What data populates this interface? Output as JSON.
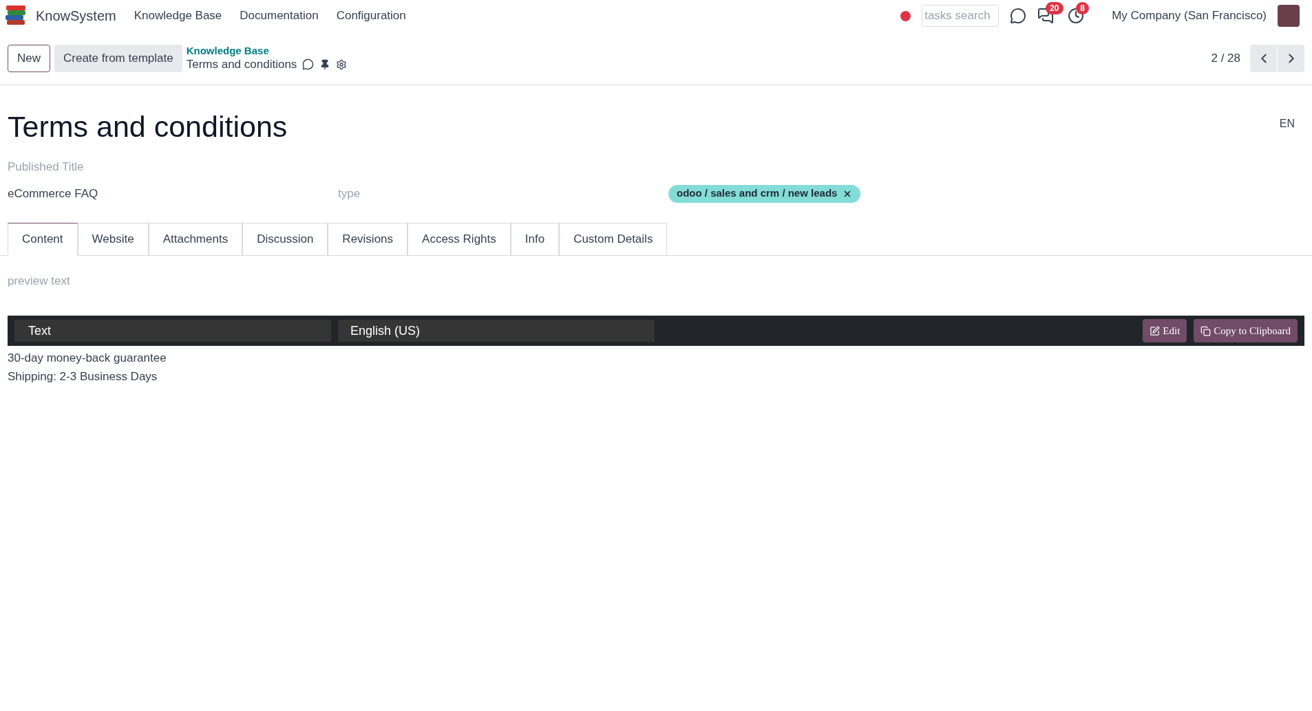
{
  "app": {
    "name": "KnowSystem"
  },
  "menu": [
    "Knowledge Base",
    "Documentation",
    "Configuration"
  ],
  "systray": {
    "recording": true,
    "search": {
      "placeholder": "tasks search"
    },
    "messages_badge": "20",
    "activities_badge": "8",
    "company": "My Company (San Francisco)"
  },
  "control_panel": {
    "buttons": [
      {
        "label": "New",
        "kind": "outline"
      },
      {
        "label": "Create from template",
        "kind": "secondary"
      }
    ],
    "breadcrumb": "Knowledge Base",
    "current": "Terms and conditions",
    "pager": "2 / 28"
  },
  "form": {
    "title": "Terms and conditions",
    "language": "EN",
    "published_title_placeholder": "Published Title",
    "section": "eCommerce FAQ",
    "type_placeholder": "type",
    "tags": [
      {
        "label": "odoo / sales and crm / new leads",
        "color": "#83dcd7"
      }
    ]
  },
  "tabs": [
    {
      "label": "Content",
      "selected": true
    },
    {
      "label": "Website",
      "selected": false
    },
    {
      "label": "Attachments",
      "selected": false
    },
    {
      "label": "Discussion",
      "selected": false
    },
    {
      "label": "Revisions",
      "selected": false
    },
    {
      "label": "Access Rights",
      "selected": false
    },
    {
      "label": "Info",
      "selected": false
    },
    {
      "label": "Custom Details",
      "selected": false
    }
  ],
  "content": {
    "preview_placeholder": "preview text",
    "editor": {
      "style": "Text",
      "language": "English (US)",
      "buttons": [
        {
          "label": "Edit",
          "kind": "edit"
        },
        {
          "label": "Copy to Clipboard",
          "kind": "copy"
        }
      ]
    },
    "lines": [
      "30-day money-back guarantee",
      "Shipping: 2-3 Business Days"
    ]
  }
}
